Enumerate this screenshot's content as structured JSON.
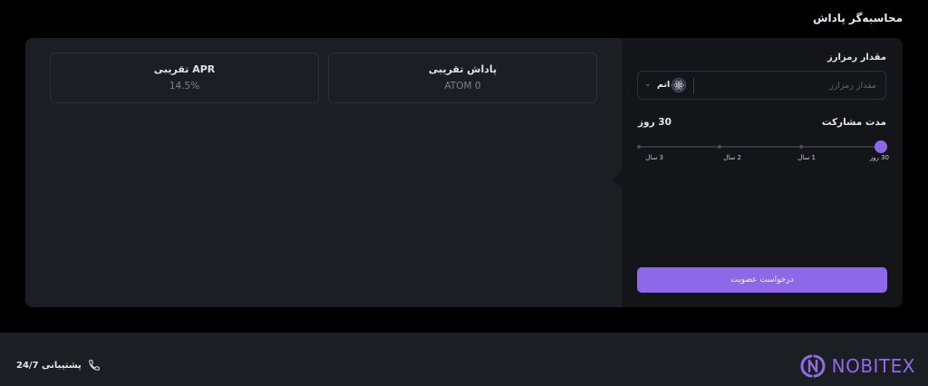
{
  "page": {
    "title": "محاسبه‌گر پاداش"
  },
  "stats": {
    "reward": {
      "label": "پاداش تقریبی",
      "value": "ATOM 0"
    },
    "apr": {
      "label": "APR تقریبی",
      "value": "14.5%"
    }
  },
  "form": {
    "amount_label": "مقدار رمزارز",
    "amount_placeholder": "مقدار رمزارز",
    "amount_value": "",
    "coin": {
      "name": "اتم",
      "icon": "atom-icon"
    },
    "duration_label": "مدت مشارکت",
    "duration_value": "30 روز",
    "slider": {
      "ticks": [
        "30 روز",
        "1 سال",
        "2 سال",
        "3 سال"
      ],
      "selected_index": 0
    },
    "submit_label": "درخواست عضویت"
  },
  "footer": {
    "logo_text": "NOBITEX",
    "support_text": "پشتیبانی 24/7",
    "support_icon": "phone-icon"
  },
  "colors": {
    "accent": "#8d68e8",
    "background": "#000000",
    "card": "#1b1e23",
    "panel": "#131518"
  }
}
